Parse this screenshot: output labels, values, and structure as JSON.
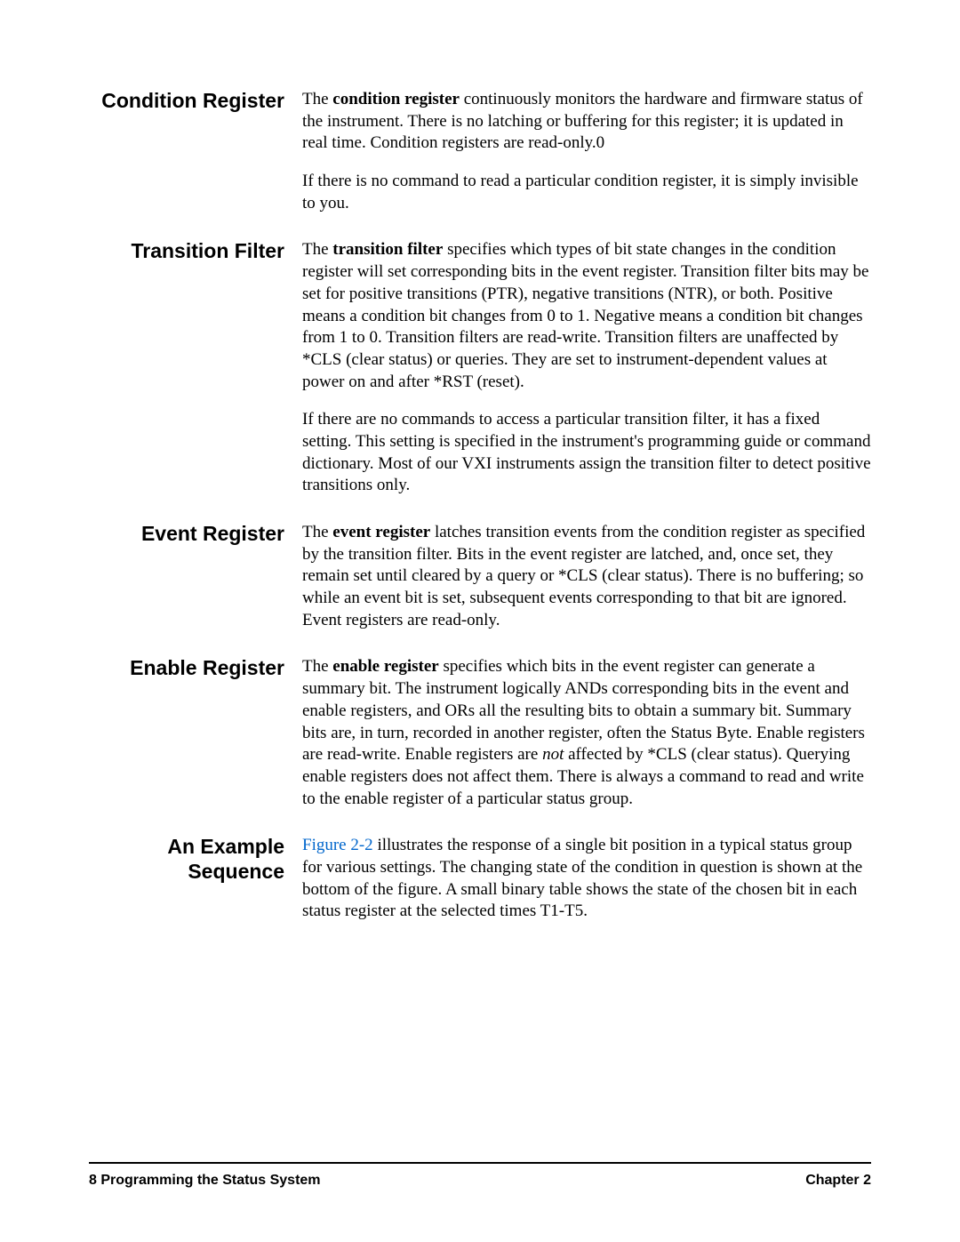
{
  "sections": {
    "condition": {
      "heading": "Condition Register",
      "p1a": "The ",
      "p1b": "condition register",
      "p1c": " continuously monitors the hardware and firmware status of the instrument.  There is no latching or buffering for this register; it is updated in real time.  Condition registers are read-only.0",
      "p2": "If there is no command to read a particular condition register, it is simply invisible to you."
    },
    "transition": {
      "heading": "Transition Filter",
      "p1a": "The ",
      "p1b": "transition filter",
      "p1c": " specifies which types of bit state changes in the condition register will set corresponding bits in the event register.  Transition filter bits may be set for positive transitions (PTR), negative transitions (NTR), or both.  Positive means a condition bit changes from 0 to 1.  Negative means a condition bit changes from 1 to 0.  Transition filters are read-write.  Transition filters are unaffected by *CLS (clear status) or queries.  They are set to instrument-dependent values at power on and after *RST (reset).",
      "p2": "If there are no commands to access a particular transition filter, it has a fixed setting.  This setting is specified in the instrument's programming guide or command dictionary.  Most of our VXI instruments assign the transition filter to detect positive transitions only."
    },
    "event": {
      "heading": "Event Register",
      "p1a": "The ",
      "p1b": "event register",
      "p1c": " latches transition events from the condition register as specified by the transition filter.  Bits in the event register are latched, and, once set, they remain set until cleared by a query or *CLS (clear status).  There is no buffering; so while an event bit is set, subsequent events corresponding to that bit are ignored.  Event registers are read-only."
    },
    "enable": {
      "heading": "Enable Register",
      "p1a": "The ",
      "p1b": "enable register",
      "p1c": " specifies which bits in the event register can generate a summary bit.  The instrument logically ANDs corresponding bits in the event and enable registers, and ORs all the resulting bits to obtain a summary bit.  Summary bits are, in turn, recorded in another register, often the Status Byte.  Enable registers are read-write.  Enable registers are ",
      "p1d": "not",
      "p1e": " affected by *CLS (clear status).  Querying enable registers does not affect them.  There is always a command to read and write to the enable register of a particular status group."
    },
    "example": {
      "heading": "An Example Sequence",
      "p1a": "Figure 2-2",
      "p1b": " illustrates the response of a single bit position in a typical status group for various settings.  The changing state of the condition in question is shown at the bottom of the figure.  A small binary table shows the state of the chosen bit in each status register at the selected times T1-T5."
    }
  },
  "footer": {
    "left_page": "8",
    "left_title": "   Programming the Status System",
    "right": "Chapter 2"
  }
}
